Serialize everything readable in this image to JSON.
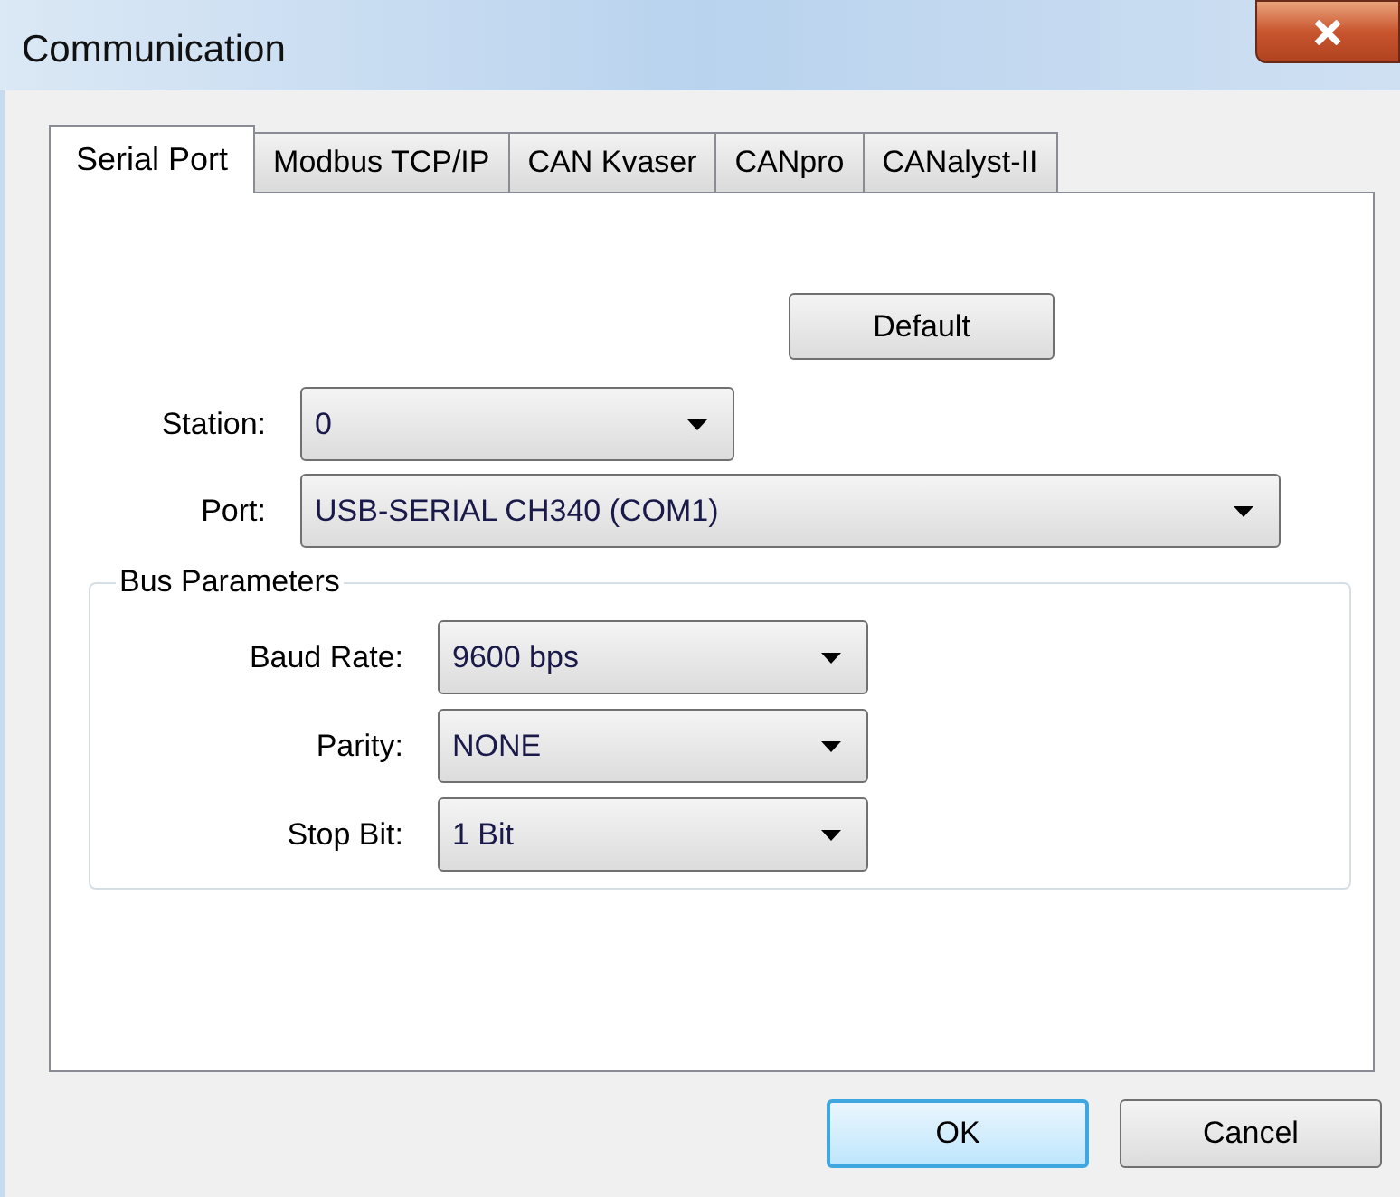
{
  "window": {
    "title": "Communication"
  },
  "tabs": [
    {
      "label": "Serial Port",
      "selected": true
    },
    {
      "label": "Modbus TCP/IP",
      "selected": false
    },
    {
      "label": "CAN Kvaser",
      "selected": false
    },
    {
      "label": "CANpro",
      "selected": false
    },
    {
      "label": "CANalyst-II",
      "selected": false
    }
  ],
  "default_button": "Default",
  "fields": [
    {
      "label": "Station:",
      "value": "0",
      "wide": false
    },
    {
      "label": "Port:",
      "value": "USB-SERIAL CH340 (COM1)",
      "wide": true
    }
  ],
  "bus_parameters": {
    "title": "Bus Parameters",
    "fields": [
      {
        "label": "Baud Rate:",
        "value": "9600 bps"
      },
      {
        "label": "Parity:",
        "value": "NONE"
      },
      {
        "label": "Stop Bit:",
        "value": "1 Bit"
      }
    ]
  },
  "buttons": [
    {
      "label": "OK",
      "focused": true
    },
    {
      "label": "Cancel",
      "focused": false
    }
  ]
}
